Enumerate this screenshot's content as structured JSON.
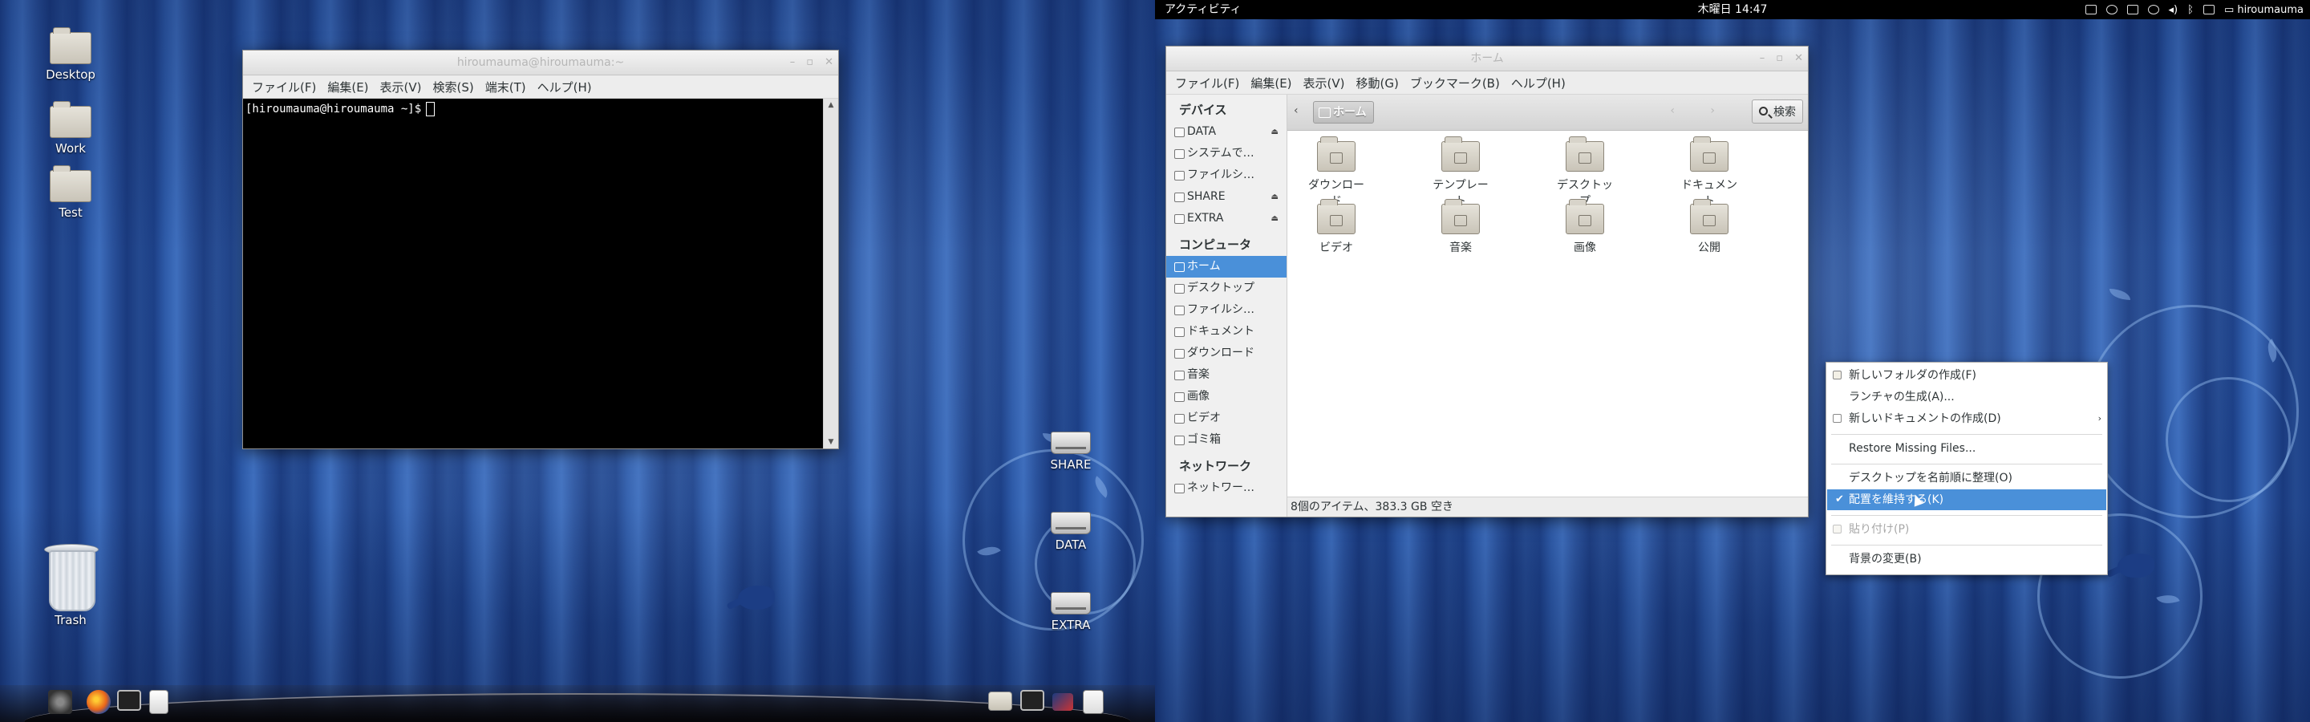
{
  "left_screen": {
    "desktop_icons": [
      {
        "label": "Desktop",
        "icon": "folder-icon"
      },
      {
        "label": "Work",
        "icon": "folder-icon"
      },
      {
        "label": "Test",
        "icon": "folder-icon"
      },
      {
        "label": "Trash",
        "icon": "trash-icon"
      },
      {
        "label": "SHARE",
        "icon": "drive-icon"
      },
      {
        "label": "DATA",
        "icon": "drive-icon"
      },
      {
        "label": "EXTRA",
        "icon": "drive-icon"
      }
    ],
    "terminal": {
      "title": "hiroumauma@hiroumauma:~",
      "menu": [
        "ファイル(F)",
        "編集(E)",
        "表示(V)",
        "検索(S)",
        "端末(T)",
        "ヘルプ(H)"
      ],
      "prompt": "[hiroumauma@hiroumauma ~]$"
    },
    "dock_icons": [
      "spider-icon",
      "firefox-icon",
      "terminal-icon",
      "document-icon",
      "file-manager-icon",
      "terminal-icon",
      "flag-icon",
      "paint-icon"
    ]
  },
  "right_screen": {
    "topbar": {
      "activities": "アクティビティ",
      "clock": "木曜日 14:47",
      "user": "hiroumauma",
      "tray_icons": [
        "keyboard-icon",
        "accessibility-icon",
        "folder-icon",
        "a11y-icon",
        "volume-icon",
        "bluetooth-icon",
        "network-icon",
        "chat-icon"
      ]
    },
    "file_manager": {
      "title": "ホーム",
      "menu": [
        "ファイル(F)",
        "編集(E)",
        "表示(V)",
        "移動(G)",
        "ブックマーク(B)",
        "ヘルプ(H)"
      ],
      "sidebar": {
        "devices_header": "デバイス",
        "devices": [
          "DATA",
          "システムで…",
          "ファイルシ…",
          "SHARE",
          "EXTRA"
        ],
        "computer_header": "コンピュータ",
        "places": [
          "ホーム",
          "デスクトップ",
          "ファイルシ…",
          "ドキュメント",
          "ダウンロード",
          "音楽",
          "画像",
          "ビデオ",
          "ゴミ箱"
        ],
        "network_header": "ネットワーク",
        "network": [
          "ネットワー…"
        ]
      },
      "path": "ホーム",
      "search_label": "検索",
      "items": [
        "ダウンロード",
        "テンプレート",
        "デスクトップ",
        "ドキュメント",
        "ビデオ",
        "音楽",
        "画像",
        "公開"
      ],
      "status": "8個のアイテム、383.3 GB 空き"
    },
    "context_menu": {
      "new_folder": "新しいフォルダの作成(F)",
      "create_launcher": "ランチャの生成(A)...",
      "new_document": "新しいドキュメントの作成(D)",
      "restore_missing": "Restore Missing Files...",
      "sort_by_name": "デスクトップを名前順に整理(O)",
      "keep_aligned": "配置を維持する(K)",
      "paste": "貼り付け(P)",
      "change_background": "背景の変更(B)"
    }
  },
  "colors": {
    "selection": "#4a90d9",
    "topbar": "#000000",
    "terminal_bg": "#000000",
    "wallpaper": "#2d5aa8"
  }
}
